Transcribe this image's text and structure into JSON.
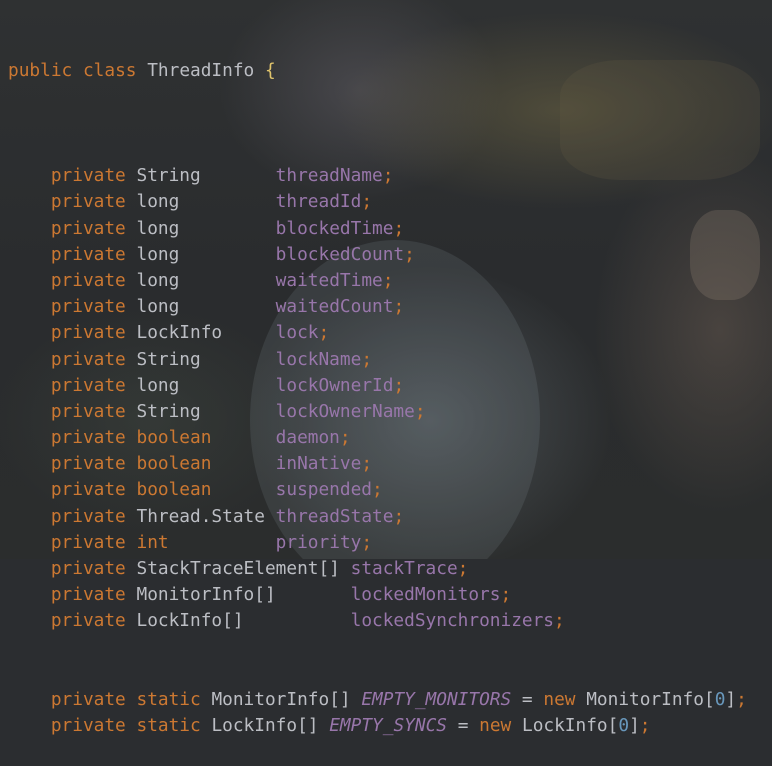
{
  "header": {
    "modifier": "public",
    "class_keyword": "class",
    "class_name": "ThreadInfo",
    "brace": "{"
  },
  "fields": [
    {
      "mod": "private",
      "type": "String",
      "pad": "       ",
      "name": "threadName"
    },
    {
      "mod": "private",
      "type": "long",
      "pad": "         ",
      "name": "threadId"
    },
    {
      "mod": "private",
      "type": "long",
      "pad": "         ",
      "name": "blockedTime"
    },
    {
      "mod": "private",
      "type": "long",
      "pad": "         ",
      "name": "blockedCount"
    },
    {
      "mod": "private",
      "type": "long",
      "pad": "         ",
      "name": "waitedTime"
    },
    {
      "mod": "private",
      "type": "long",
      "pad": "         ",
      "name": "waitedCount"
    },
    {
      "mod": "private",
      "type": "LockInfo",
      "pad": "     ",
      "name": "lock"
    },
    {
      "mod": "private",
      "type": "String",
      "pad": "       ",
      "name": "lockName"
    },
    {
      "mod": "private",
      "type": "long",
      "pad": "         ",
      "name": "lockOwnerId"
    },
    {
      "mod": "private",
      "type": "String",
      "pad": "       ",
      "name": "lockOwnerName"
    },
    {
      "mod": "private",
      "type": "boolean",
      "pad": "      ",
      "name": "daemon",
      "primitive": true
    },
    {
      "mod": "private",
      "type": "boolean",
      "pad": "      ",
      "name": "inNative",
      "primitive": true
    },
    {
      "mod": "private",
      "type": "boolean",
      "pad": "      ",
      "name": "suspended",
      "primitive": true
    },
    {
      "mod": "private",
      "type": "Thread.State",
      "pad": " ",
      "name": "threadState"
    },
    {
      "mod": "private",
      "type": "int",
      "pad": "          ",
      "name": "priority",
      "primitive": true
    },
    {
      "mod": "private",
      "type": "StackTraceElement[]",
      "pad": " ",
      "name": "stackTrace"
    },
    {
      "mod": "private",
      "type": "MonitorInfo[]",
      "pad": "       ",
      "name": "lockedMonitors"
    },
    {
      "mod": "private",
      "type": "LockInfo[]",
      "pad": "          ",
      "name": "lockedSynchronizers"
    }
  ],
  "constants": [
    {
      "mod": "private",
      "static": "static",
      "type": "MonitorInfo[]",
      "name": "EMPTY_MONITORS",
      "eq": "=",
      "new": "new",
      "ctor": "MonitorInfo",
      "index": "0"
    },
    {
      "mod": "private",
      "static": "static",
      "type": "LockInfo[]",
      "name": "EMPTY_SYNCS",
      "eq": "=",
      "new": "new",
      "ctor": "LockInfo",
      "index": "0"
    }
  ],
  "colors": {
    "keyword": "#cc7832",
    "field": "#9876aa",
    "type": "#bcbec4",
    "number": "#6897bb",
    "background": "#2b2d30"
  }
}
